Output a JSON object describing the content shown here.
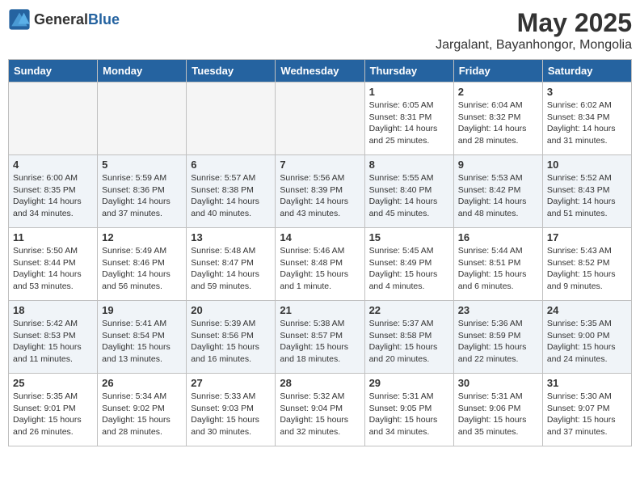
{
  "header": {
    "logo_general": "General",
    "logo_blue": "Blue",
    "title": "May 2025",
    "subtitle": "Jargalant, Bayanhongor, Mongolia"
  },
  "days_of_week": [
    "Sunday",
    "Monday",
    "Tuesday",
    "Wednesday",
    "Thursday",
    "Friday",
    "Saturday"
  ],
  "weeks": [
    {
      "shaded": false,
      "days": [
        {
          "num": "",
          "info": "",
          "empty": true
        },
        {
          "num": "",
          "info": "",
          "empty": true
        },
        {
          "num": "",
          "info": "",
          "empty": true
        },
        {
          "num": "",
          "info": "",
          "empty": true
        },
        {
          "num": "1",
          "info": "Sunrise: 6:05 AM\nSunset: 8:31 PM\nDaylight: 14 hours\nand 25 minutes.",
          "empty": false
        },
        {
          "num": "2",
          "info": "Sunrise: 6:04 AM\nSunset: 8:32 PM\nDaylight: 14 hours\nand 28 minutes.",
          "empty": false
        },
        {
          "num": "3",
          "info": "Sunrise: 6:02 AM\nSunset: 8:34 PM\nDaylight: 14 hours\nand 31 minutes.",
          "empty": false
        }
      ]
    },
    {
      "shaded": true,
      "days": [
        {
          "num": "4",
          "info": "Sunrise: 6:00 AM\nSunset: 8:35 PM\nDaylight: 14 hours\nand 34 minutes.",
          "empty": false
        },
        {
          "num": "5",
          "info": "Sunrise: 5:59 AM\nSunset: 8:36 PM\nDaylight: 14 hours\nand 37 minutes.",
          "empty": false
        },
        {
          "num": "6",
          "info": "Sunrise: 5:57 AM\nSunset: 8:38 PM\nDaylight: 14 hours\nand 40 minutes.",
          "empty": false
        },
        {
          "num": "7",
          "info": "Sunrise: 5:56 AM\nSunset: 8:39 PM\nDaylight: 14 hours\nand 43 minutes.",
          "empty": false
        },
        {
          "num": "8",
          "info": "Sunrise: 5:55 AM\nSunset: 8:40 PM\nDaylight: 14 hours\nand 45 minutes.",
          "empty": false
        },
        {
          "num": "9",
          "info": "Sunrise: 5:53 AM\nSunset: 8:42 PM\nDaylight: 14 hours\nand 48 minutes.",
          "empty": false
        },
        {
          "num": "10",
          "info": "Sunrise: 5:52 AM\nSunset: 8:43 PM\nDaylight: 14 hours\nand 51 minutes.",
          "empty": false
        }
      ]
    },
    {
      "shaded": false,
      "days": [
        {
          "num": "11",
          "info": "Sunrise: 5:50 AM\nSunset: 8:44 PM\nDaylight: 14 hours\nand 53 minutes.",
          "empty": false
        },
        {
          "num": "12",
          "info": "Sunrise: 5:49 AM\nSunset: 8:46 PM\nDaylight: 14 hours\nand 56 minutes.",
          "empty": false
        },
        {
          "num": "13",
          "info": "Sunrise: 5:48 AM\nSunset: 8:47 PM\nDaylight: 14 hours\nand 59 minutes.",
          "empty": false
        },
        {
          "num": "14",
          "info": "Sunrise: 5:46 AM\nSunset: 8:48 PM\nDaylight: 15 hours\nand 1 minute.",
          "empty": false
        },
        {
          "num": "15",
          "info": "Sunrise: 5:45 AM\nSunset: 8:49 PM\nDaylight: 15 hours\nand 4 minutes.",
          "empty": false
        },
        {
          "num": "16",
          "info": "Sunrise: 5:44 AM\nSunset: 8:51 PM\nDaylight: 15 hours\nand 6 minutes.",
          "empty": false
        },
        {
          "num": "17",
          "info": "Sunrise: 5:43 AM\nSunset: 8:52 PM\nDaylight: 15 hours\nand 9 minutes.",
          "empty": false
        }
      ]
    },
    {
      "shaded": true,
      "days": [
        {
          "num": "18",
          "info": "Sunrise: 5:42 AM\nSunset: 8:53 PM\nDaylight: 15 hours\nand 11 minutes.",
          "empty": false
        },
        {
          "num": "19",
          "info": "Sunrise: 5:41 AM\nSunset: 8:54 PM\nDaylight: 15 hours\nand 13 minutes.",
          "empty": false
        },
        {
          "num": "20",
          "info": "Sunrise: 5:39 AM\nSunset: 8:56 PM\nDaylight: 15 hours\nand 16 minutes.",
          "empty": false
        },
        {
          "num": "21",
          "info": "Sunrise: 5:38 AM\nSunset: 8:57 PM\nDaylight: 15 hours\nand 18 minutes.",
          "empty": false
        },
        {
          "num": "22",
          "info": "Sunrise: 5:37 AM\nSunset: 8:58 PM\nDaylight: 15 hours\nand 20 minutes.",
          "empty": false
        },
        {
          "num": "23",
          "info": "Sunrise: 5:36 AM\nSunset: 8:59 PM\nDaylight: 15 hours\nand 22 minutes.",
          "empty": false
        },
        {
          "num": "24",
          "info": "Sunrise: 5:35 AM\nSunset: 9:00 PM\nDaylight: 15 hours\nand 24 minutes.",
          "empty": false
        }
      ]
    },
    {
      "shaded": false,
      "days": [
        {
          "num": "25",
          "info": "Sunrise: 5:35 AM\nSunset: 9:01 PM\nDaylight: 15 hours\nand 26 minutes.",
          "empty": false
        },
        {
          "num": "26",
          "info": "Sunrise: 5:34 AM\nSunset: 9:02 PM\nDaylight: 15 hours\nand 28 minutes.",
          "empty": false
        },
        {
          "num": "27",
          "info": "Sunrise: 5:33 AM\nSunset: 9:03 PM\nDaylight: 15 hours\nand 30 minutes.",
          "empty": false
        },
        {
          "num": "28",
          "info": "Sunrise: 5:32 AM\nSunset: 9:04 PM\nDaylight: 15 hours\nand 32 minutes.",
          "empty": false
        },
        {
          "num": "29",
          "info": "Sunrise: 5:31 AM\nSunset: 9:05 PM\nDaylight: 15 hours\nand 34 minutes.",
          "empty": false
        },
        {
          "num": "30",
          "info": "Sunrise: 5:31 AM\nSunset: 9:06 PM\nDaylight: 15 hours\nand 35 minutes.",
          "empty": false
        },
        {
          "num": "31",
          "info": "Sunrise: 5:30 AM\nSunset: 9:07 PM\nDaylight: 15 hours\nand 37 minutes.",
          "empty": false
        }
      ]
    }
  ]
}
